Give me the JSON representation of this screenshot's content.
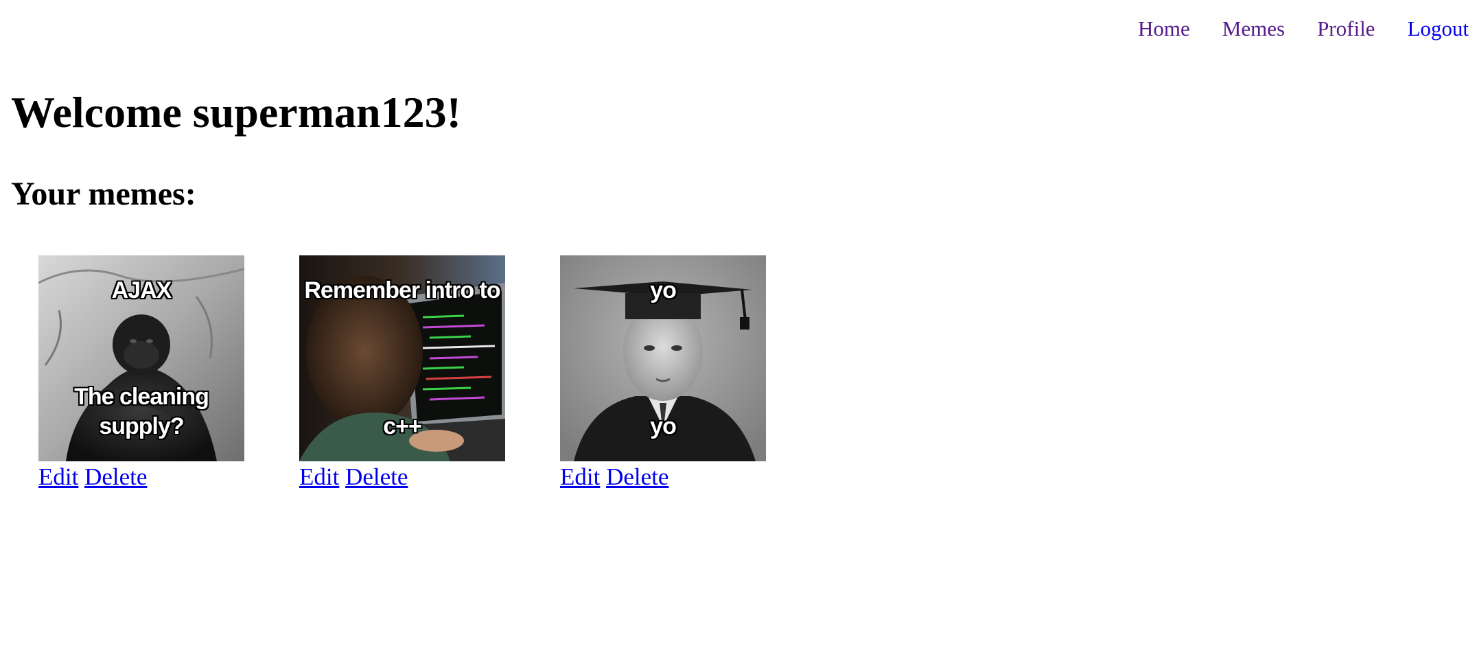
{
  "nav": {
    "home": "Home",
    "memes": "Memes",
    "profile": "Profile",
    "logout": "Logout"
  },
  "page": {
    "welcome": "Welcome superman123!",
    "subheading": "Your memes:"
  },
  "memes": [
    {
      "top_text": "AJAX",
      "bottom_text": "The cleaning supply?",
      "image": "gorilla-photo"
    },
    {
      "top_text": "Remember intro to",
      "bottom_text": "c++",
      "image": "laptop-coding-photo"
    },
    {
      "top_text": "yo",
      "bottom_text": "yo",
      "image": "graduate-portrait-photo"
    }
  ],
  "actions": {
    "edit": "Edit",
    "delete": "Delete"
  },
  "colors": {
    "link": "#0000EE",
    "visited_link": "#551A8B"
  }
}
